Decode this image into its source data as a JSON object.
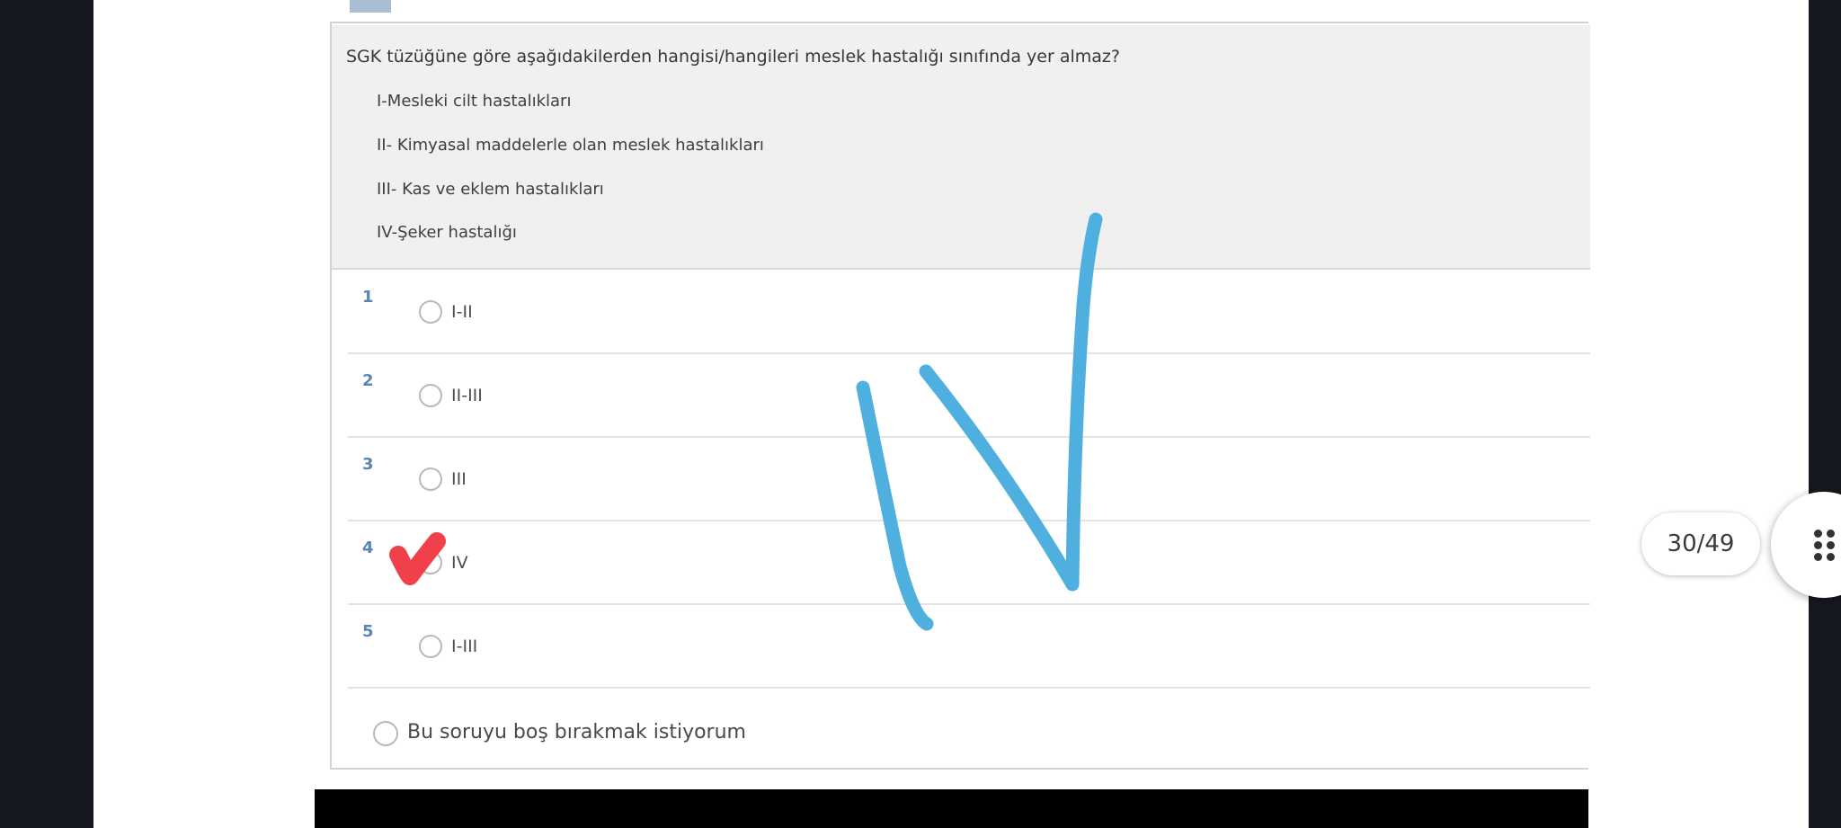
{
  "question": {
    "text": "SGK tüzüğüne göre aşağıdakilerden hangisi/hangileri meslek hastalığı sınıfında yer almaz?",
    "statements": [
      "I-Mesleki cilt hastalıkları",
      "II- Kimyasal maddelerle olan meslek hastalıkları",
      "III- Kas ve eklem hastalıkları",
      "IV-Şeker hastalığı"
    ]
  },
  "options": [
    {
      "number": "1",
      "label": "I-II"
    },
    {
      "number": "2",
      "label": "II-III"
    },
    {
      "number": "3",
      "label": "III"
    },
    {
      "number": "4",
      "label": "IV",
      "marked": true
    },
    {
      "number": "5",
      "label": "I-III"
    }
  ],
  "skip_label": "Bu soruyu boş bırakmak istiyorum",
  "page_counter": "30/49",
  "annotations": {
    "check_color": "#f0414b",
    "handwriting_color": "#4fb0e0",
    "icons": [
      "check-mark-icon",
      "grid-dots-icon"
    ]
  }
}
